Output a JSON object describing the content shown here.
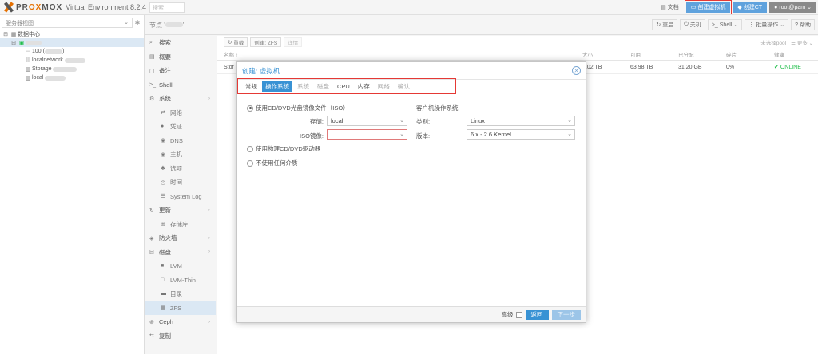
{
  "topbar": {
    "logo_left": "PR",
    "logo_ox": "OX",
    "logo_right": "MOX",
    "app_title": "Virtual Environment 8.2.4",
    "search_placeholder": "搜索",
    "docs": "文档",
    "create_vm": "创建虚拟机",
    "create_ct": "创建CT",
    "user": "root@pam"
  },
  "sidebar": {
    "view": "服务器视图",
    "datacenter": "数据中心",
    "items": [
      {
        "label": "100 (",
        "suffix": ")"
      },
      {
        "label": "localnetwork"
      },
      {
        "label": "Storage"
      },
      {
        "label": "local"
      }
    ]
  },
  "nodebar": {
    "title": "节点 '",
    "title_end": "'",
    "reboot": "重启",
    "shutdown": "关机",
    "shell": "Shell",
    "bulk": "批量操作",
    "help": "帮助"
  },
  "menu": [
    {
      "icon": "search-icon",
      "glyph": "⌕",
      "label": "搜索",
      "sub": false
    },
    {
      "icon": "book-icon",
      "glyph": "▤",
      "label": "概要",
      "sub": false
    },
    {
      "icon": "notes-icon",
      "glyph": "▢",
      "label": "备注",
      "sub": false
    },
    {
      "icon": "terminal-icon",
      "glyph": ">_",
      "label": "Shell",
      "sub": false
    },
    {
      "icon": "gears-icon",
      "glyph": "⚙",
      "label": "系统",
      "sub": false,
      "chev": true
    },
    {
      "icon": "network-icon",
      "glyph": "⇄",
      "label": "网络",
      "sub": true
    },
    {
      "icon": "certificate-icon",
      "glyph": "●",
      "label": "凭证",
      "sub": true
    },
    {
      "icon": "globe-icon",
      "glyph": "◉",
      "label": "DNS",
      "sub": true
    },
    {
      "icon": "host-icon",
      "glyph": "◉",
      "label": "主机",
      "sub": true
    },
    {
      "icon": "options-icon",
      "glyph": "✱",
      "label": "选项",
      "sub": true
    },
    {
      "icon": "clock-icon",
      "glyph": "◷",
      "label": "时间",
      "sub": true
    },
    {
      "icon": "list-icon",
      "glyph": "☰",
      "label": "System Log",
      "sub": true
    },
    {
      "icon": "refresh-icon",
      "glyph": "↻",
      "label": "更新",
      "sub": false,
      "chev": true
    },
    {
      "icon": "repository-icon",
      "glyph": "⊞",
      "label": "存储库",
      "sub": true
    },
    {
      "icon": "shield-icon",
      "glyph": "◈",
      "label": "防火墙",
      "sub": false,
      "chev": true
    },
    {
      "icon": "disk-icon",
      "glyph": "⊟",
      "label": "磁盘",
      "sub": false,
      "chev": true
    },
    {
      "icon": "lvm-icon",
      "glyph": "■",
      "label": "LVM",
      "sub": true
    },
    {
      "icon": "lvm-thin-icon",
      "glyph": "□",
      "label": "LVM-Thin",
      "sub": true
    },
    {
      "icon": "folder-icon",
      "glyph": "▬",
      "label": "目录",
      "sub": true
    },
    {
      "icon": "zfs-icon",
      "glyph": "▦",
      "label": "ZFS",
      "sub": true,
      "selected": true
    },
    {
      "icon": "ceph-icon",
      "glyph": "⊛",
      "label": "Ceph",
      "sub": false,
      "chev": true
    },
    {
      "icon": "replication-icon",
      "glyph": "⇆",
      "label": "复制",
      "sub": false
    }
  ],
  "content": {
    "reload": "重载",
    "create_zfs": "创建: ZFS",
    "detail": "详情",
    "no_pool": "未选择pool",
    "more": "更多",
    "columns": [
      "名称 ↑",
      "大小",
      "可用",
      "已分配",
      "碎片",
      "健康"
    ],
    "row": {
      "name": "Stor",
      "size": "4.02 TB",
      "free": "63.98 TB",
      "alloc": "31.20 GB",
      "frag": "0%",
      "health": "ONLINE"
    }
  },
  "modal": {
    "title": "创建: 虚拟机",
    "tabs": [
      "常规",
      "操作系统",
      "系统",
      "磁盘",
      "CPU",
      "内存",
      "网络",
      "确认"
    ],
    "active_tab": 1,
    "use_iso": "使用CD/DVD光盘镜像文件（ISO）",
    "storage_label": "存储:",
    "storage_value": "local",
    "iso_label": "ISO镜像:",
    "iso_value": "",
    "use_physical": "使用物理CD/DVD驱动器",
    "no_media": "不使用任何介质",
    "guest_os": "客户机操作系统:",
    "type_label": "类别:",
    "type_value": "Linux",
    "version_label": "版本:",
    "version_value": "6.x - 2.6 Kernel",
    "advanced": "高级",
    "back": "返回",
    "next": "下一步"
  }
}
